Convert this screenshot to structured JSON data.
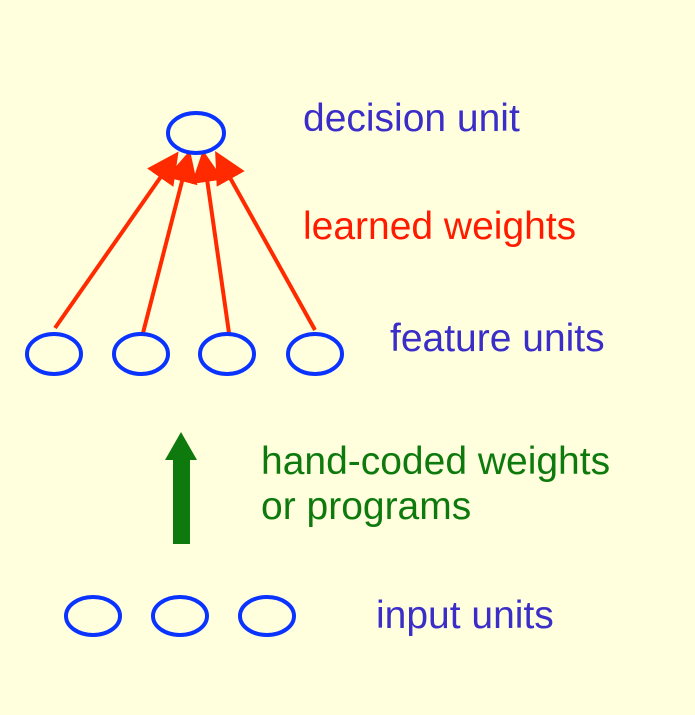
{
  "labels": {
    "decision_unit": "decision unit",
    "learned_weights": "learned weights",
    "feature_units": "feature units",
    "hand_coded_line1": "hand-coded weights",
    "hand_coded_line2": "or programs",
    "input_units": "input units"
  },
  "colors": {
    "background": "#FFFFDD",
    "unit_stroke": "#0A33FF",
    "learned_arrow": "#FF2A00",
    "hand_arrow": "#0E7A0E",
    "unit_label": "#3A2DC8"
  }
}
